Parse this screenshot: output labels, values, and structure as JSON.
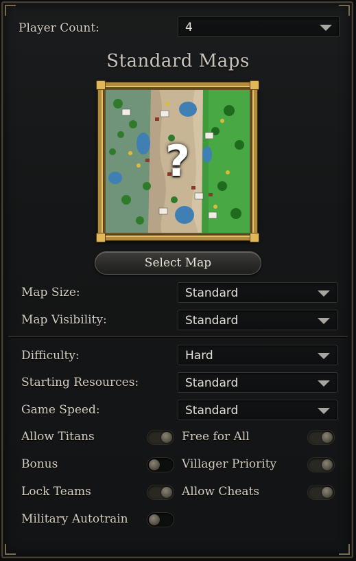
{
  "player_count": {
    "label": "Player Count:",
    "value": "4"
  },
  "map_section": {
    "title": "Standard Maps",
    "placeholder_glyph": "?",
    "select_button": "Select Map"
  },
  "map_options": {
    "map_size": {
      "label": "Map Size:",
      "value": "Standard"
    },
    "map_visibility": {
      "label": "Map Visibility:",
      "value": "Standard"
    }
  },
  "game_options": {
    "difficulty": {
      "label": "Difficulty:",
      "value": "Hard"
    },
    "starting_resources": {
      "label": "Starting Resources:",
      "value": "Standard"
    },
    "game_speed": {
      "label": "Game Speed:",
      "value": "Standard"
    }
  },
  "toggles": {
    "allow_titans": {
      "label": "Allow Titans",
      "on": true
    },
    "free_for_all": {
      "label": "Free for All",
      "on": true
    },
    "bonus": {
      "label": "Bonus",
      "on": false
    },
    "villager_priority": {
      "label": "Villager Priority",
      "on": true
    },
    "lock_teams": {
      "label": "Lock Teams",
      "on": true
    },
    "allow_cheats": {
      "label": "Allow Cheats",
      "on": true
    },
    "military_autotrain": {
      "label": "Military Autotrain",
      "on": false
    }
  },
  "colors": {
    "frame_gold": "#b28a3e",
    "panel_bg": "#141617",
    "text": "#d6cfc1"
  }
}
